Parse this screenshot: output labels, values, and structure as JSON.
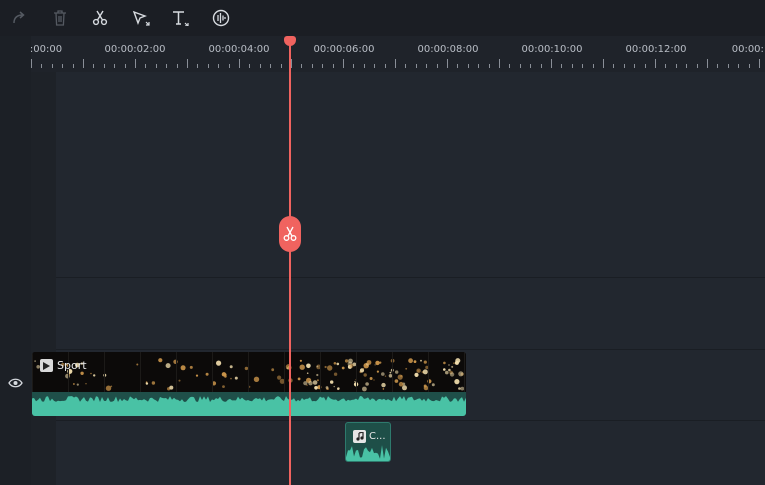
{
  "toolbar": {
    "buttons": [
      {
        "name": "redo",
        "icon": "redo-icon",
        "enabled": false
      },
      {
        "name": "delete",
        "icon": "trash-icon",
        "enabled": false
      },
      {
        "name": "split",
        "icon": "scissors-icon",
        "enabled": true
      },
      {
        "name": "crop",
        "icon": "cursor-crop-icon",
        "enabled": true
      },
      {
        "name": "text",
        "icon": "text-icon",
        "enabled": true
      },
      {
        "name": "audio",
        "icon": "audio-wave-icon",
        "enabled": true
      }
    ]
  },
  "ruler": {
    "labels": [
      ":00:00",
      "00:00:02:00",
      "00:00:04:00",
      "00:00:06:00",
      "00:00:08:00",
      "00:00:10:00",
      "00:00:12:00",
      "00:00:1"
    ]
  },
  "timeline": {
    "playhead_time_seconds": 4.8,
    "tracks": {
      "video_clip": {
        "title": "Sport",
        "icon": "play-icon"
      },
      "audio_clip": {
        "title": "C...",
        "icon": "music-note-icon"
      }
    }
  },
  "colors": {
    "playhead": "#f0635f",
    "audio_wave": "#49c2a5",
    "background": "#22272f"
  }
}
